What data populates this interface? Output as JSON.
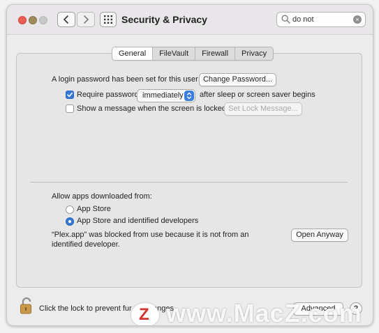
{
  "window": {
    "title": "Security & Privacy"
  },
  "search": {
    "value": "do not"
  },
  "tabs": [
    {
      "label": "General",
      "active": true
    },
    {
      "label": "FileVault",
      "active": false
    },
    {
      "label": "Firewall",
      "active": false
    },
    {
      "label": "Privacy",
      "active": false
    }
  ],
  "general": {
    "login_text": "A login password has been set for this user",
    "change_password_label": "Change Password...",
    "require_password_label": "Require password",
    "require_password_checked": true,
    "require_password_value": "immediately",
    "after_sleep_text": "after sleep or screen saver begins",
    "show_message_label": "Show a message when the screen is locked",
    "show_message_checked": false,
    "set_lock_message_label": "Set Lock Message..."
  },
  "apps": {
    "heading": "Allow apps downloaded from:",
    "options": [
      {
        "label": "App Store",
        "selected": false
      },
      {
        "label": "App Store and identified developers",
        "selected": true
      }
    ],
    "blocked_line1": "“Plex.app” was blocked from use because it is not from an",
    "blocked_line2": "identified developer.",
    "open_anyway_label": "Open Anyway"
  },
  "footer": {
    "lock_text": "Click the lock to prevent fur",
    "lock_text_tail": "anges.",
    "advanced_label": "Advanced",
    "help_label": "?"
  },
  "watermark": {
    "logo_letter": "Z",
    "text": "www.MacZ.com"
  },
  "colors": {
    "accent": "#3478d6",
    "close": "#ec5e55"
  },
  "icons": [
    "back-chevron-icon",
    "forward-chevron-icon",
    "grid-icon",
    "search-icon",
    "clear-icon",
    "lock-icon",
    "popup-arrows-icon"
  ]
}
